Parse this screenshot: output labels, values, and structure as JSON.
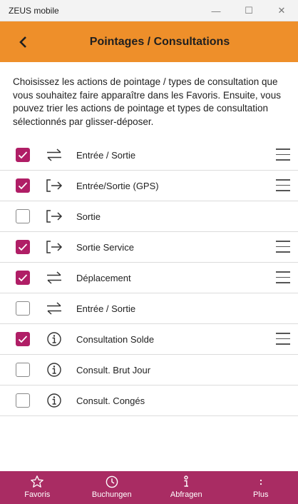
{
  "window": {
    "title": "ZEUS mobile",
    "minimize": "—",
    "maximize": "☐",
    "close": "✕"
  },
  "header": {
    "back_icon": "chevron-left-icon",
    "title": "Pointages / Consultations"
  },
  "intro": "Choisissez les actions de pointage / types de consultation que vous souhaitez faire apparaître dans les Favoris. Ensuite, vous pouvez trier les actions de pointage et types de consultation sélectionnés par glisser-déposer.",
  "items": [
    {
      "label": "Entrée / Sortie",
      "checked": true,
      "icon": "swap-arrows-icon"
    },
    {
      "label": "Entrée/Sortie (GPS)",
      "checked": true,
      "icon": "exit-arrow-icon"
    },
    {
      "label": "Sortie",
      "checked": false,
      "icon": "exit-arrow-icon"
    },
    {
      "label": "Sortie Service",
      "checked": true,
      "icon": "exit-arrow-icon"
    },
    {
      "label": "Déplacement",
      "checked": true,
      "icon": "swap-arrows-icon"
    },
    {
      "label": "Entrée / Sortie",
      "checked": false,
      "icon": "swap-arrows-icon"
    },
    {
      "label": "Consultation Solde",
      "checked": true,
      "icon": "info-icon"
    },
    {
      "label": "Consult. Brut Jour",
      "checked": false,
      "icon": "info-icon"
    },
    {
      "label": "Consult. Congés",
      "checked": false,
      "icon": "info-icon"
    }
  ],
  "nav": [
    {
      "label": "Favoris",
      "icon": "star-icon"
    },
    {
      "label": "Buchungen",
      "icon": "clock-icon"
    },
    {
      "label": "Abfragen",
      "icon": "info-i-icon"
    },
    {
      "label": "Plus",
      "icon": "more-icon"
    }
  ],
  "colors": {
    "header": "#ee8f2a",
    "accent": "#b01e66",
    "nav": "#a92c63"
  }
}
